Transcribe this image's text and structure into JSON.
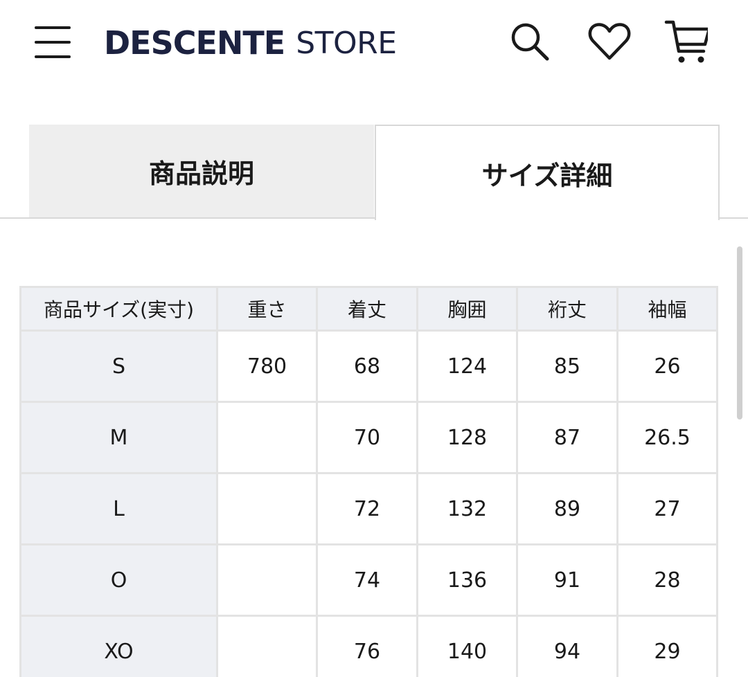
{
  "header": {
    "brand": "DESCENTE",
    "store": "STORE",
    "icons": {
      "menu": "hamburger-menu-icon",
      "search": "search-icon",
      "favorite": "heart-icon",
      "cart": "cart-icon"
    }
  },
  "tabs": [
    {
      "label": "商品説明",
      "active": false
    },
    {
      "label": "サイズ詳細",
      "active": true
    }
  ],
  "size_table": {
    "headers": [
      "商品サイズ(実寸)",
      "重さ",
      "着丈",
      "胸囲",
      "裄丈",
      "袖幅"
    ],
    "rows": [
      [
        "S",
        "780",
        "68",
        "124",
        "85",
        "26"
      ],
      [
        "M",
        "",
        "70",
        "128",
        "87",
        "26.5"
      ],
      [
        "L",
        "",
        "72",
        "132",
        "89",
        "27"
      ],
      [
        "O",
        "",
        "74",
        "136",
        "91",
        "28"
      ],
      [
        "XO",
        "",
        "76",
        "140",
        "94",
        "29"
      ]
    ]
  },
  "colors": {
    "brand_navy": "#1c2240",
    "text": "#1a1a1a",
    "tab_inactive_bg": "#eeeeee",
    "table_header_bg": "#eef0f4",
    "border": "#e3e3e3"
  }
}
